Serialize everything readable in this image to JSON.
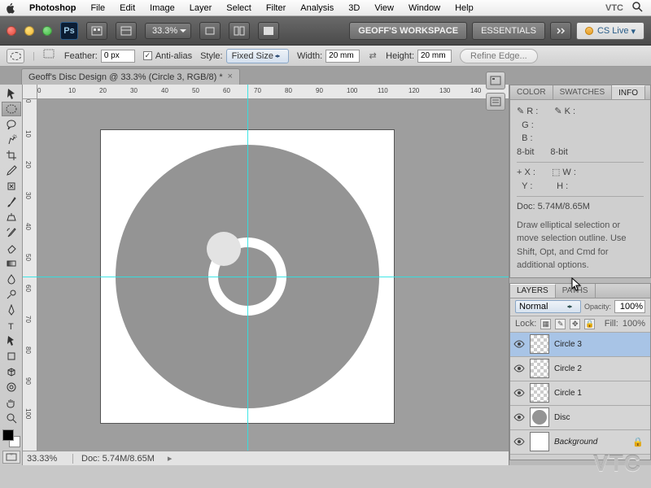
{
  "menubar": {
    "app": "Photoshop",
    "items": [
      "File",
      "Edit",
      "Image",
      "Layer",
      "Select",
      "Filter",
      "Analysis",
      "3D",
      "View",
      "Window",
      "Help"
    ],
    "right_label": "VTC"
  },
  "appbar": {
    "zoom": "33.3%",
    "workspace": "GEOFF'S WORKSPACE",
    "essentials": "ESSENTIALS",
    "cslive": "CS Live"
  },
  "optbar": {
    "feather_label": "Feather:",
    "feather": "0 px",
    "aa": "Anti-alias",
    "style_label": "Style:",
    "style": "Fixed Size",
    "width_label": "Width:",
    "width": "20 mm",
    "height_label": "Height:",
    "height": "20 mm",
    "refine": "Refine Edge..."
  },
  "doctab": "Geoff's Disc Design @ 33.3% (Circle 3, RGB/8) *",
  "ruler_h": [
    "0",
    "10",
    "20",
    "30",
    "40",
    "50",
    "60",
    "70",
    "80",
    "90",
    "100",
    "110",
    "120",
    "130",
    "140"
  ],
  "ruler_v": [
    "0",
    "10",
    "20",
    "30",
    "40",
    "50",
    "60",
    "70",
    "80",
    "90",
    "100"
  ],
  "status": {
    "zoom": "33.33%",
    "doc": "Doc: 5.74M/8.65M"
  },
  "panels": {
    "info": {
      "tabs": [
        "COLOR",
        "SWATCHES",
        "INFO"
      ],
      "rgb": [
        "R :",
        "G :",
        "B :"
      ],
      "k": "K :",
      "bit1": "8-bit",
      "bit2": "8-bit",
      "xy": [
        "X :",
        "Y :"
      ],
      "wh": [
        "W :",
        "H :"
      ],
      "doc": "Doc: 5.74M/8.65M",
      "hint": "Draw elliptical selection or move selection outline. Use Shift, Opt, and Cmd for additional options."
    },
    "layers": {
      "tabs": [
        "LAYERS",
        "PATHS"
      ],
      "blend": "Normal",
      "opacity_label": "Opacity:",
      "opacity": "100%",
      "lock_label": "Lock:",
      "fill_label": "Fill:",
      "fill": "100%",
      "items": [
        {
          "name": "Circle 3",
          "sel": true,
          "checker": true
        },
        {
          "name": "Circle 2",
          "checker": true
        },
        {
          "name": "Circle 1",
          "checker": true
        },
        {
          "name": "Disc",
          "disc": true
        },
        {
          "name": "Background",
          "ital": true,
          "locked": true
        }
      ]
    }
  }
}
